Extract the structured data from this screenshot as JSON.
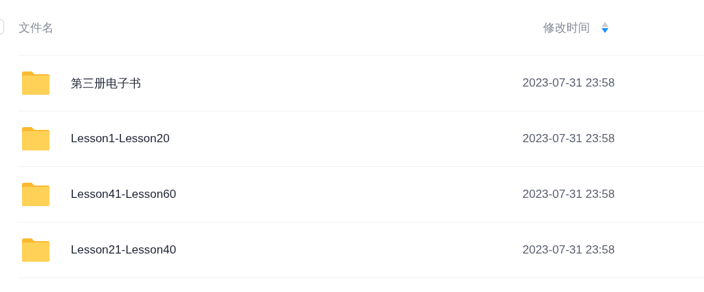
{
  "header": {
    "select_all_checked": false,
    "name_label": "文件名",
    "time_label": "修改时间",
    "sort_descending": true
  },
  "rows": [
    {
      "kind": "folder",
      "name": "第三册电子书",
      "modified": "2023-07-31 23:58"
    },
    {
      "kind": "folder",
      "name": "Lesson1-Lesson20",
      "modified": "2023-07-31 23:58"
    },
    {
      "kind": "folder",
      "name": "Lesson41-Lesson60",
      "modified": "2023-07-31 23:58"
    },
    {
      "kind": "folder",
      "name": "Lesson21-Lesson40",
      "modified": "2023-07-31 23:58"
    }
  ]
}
